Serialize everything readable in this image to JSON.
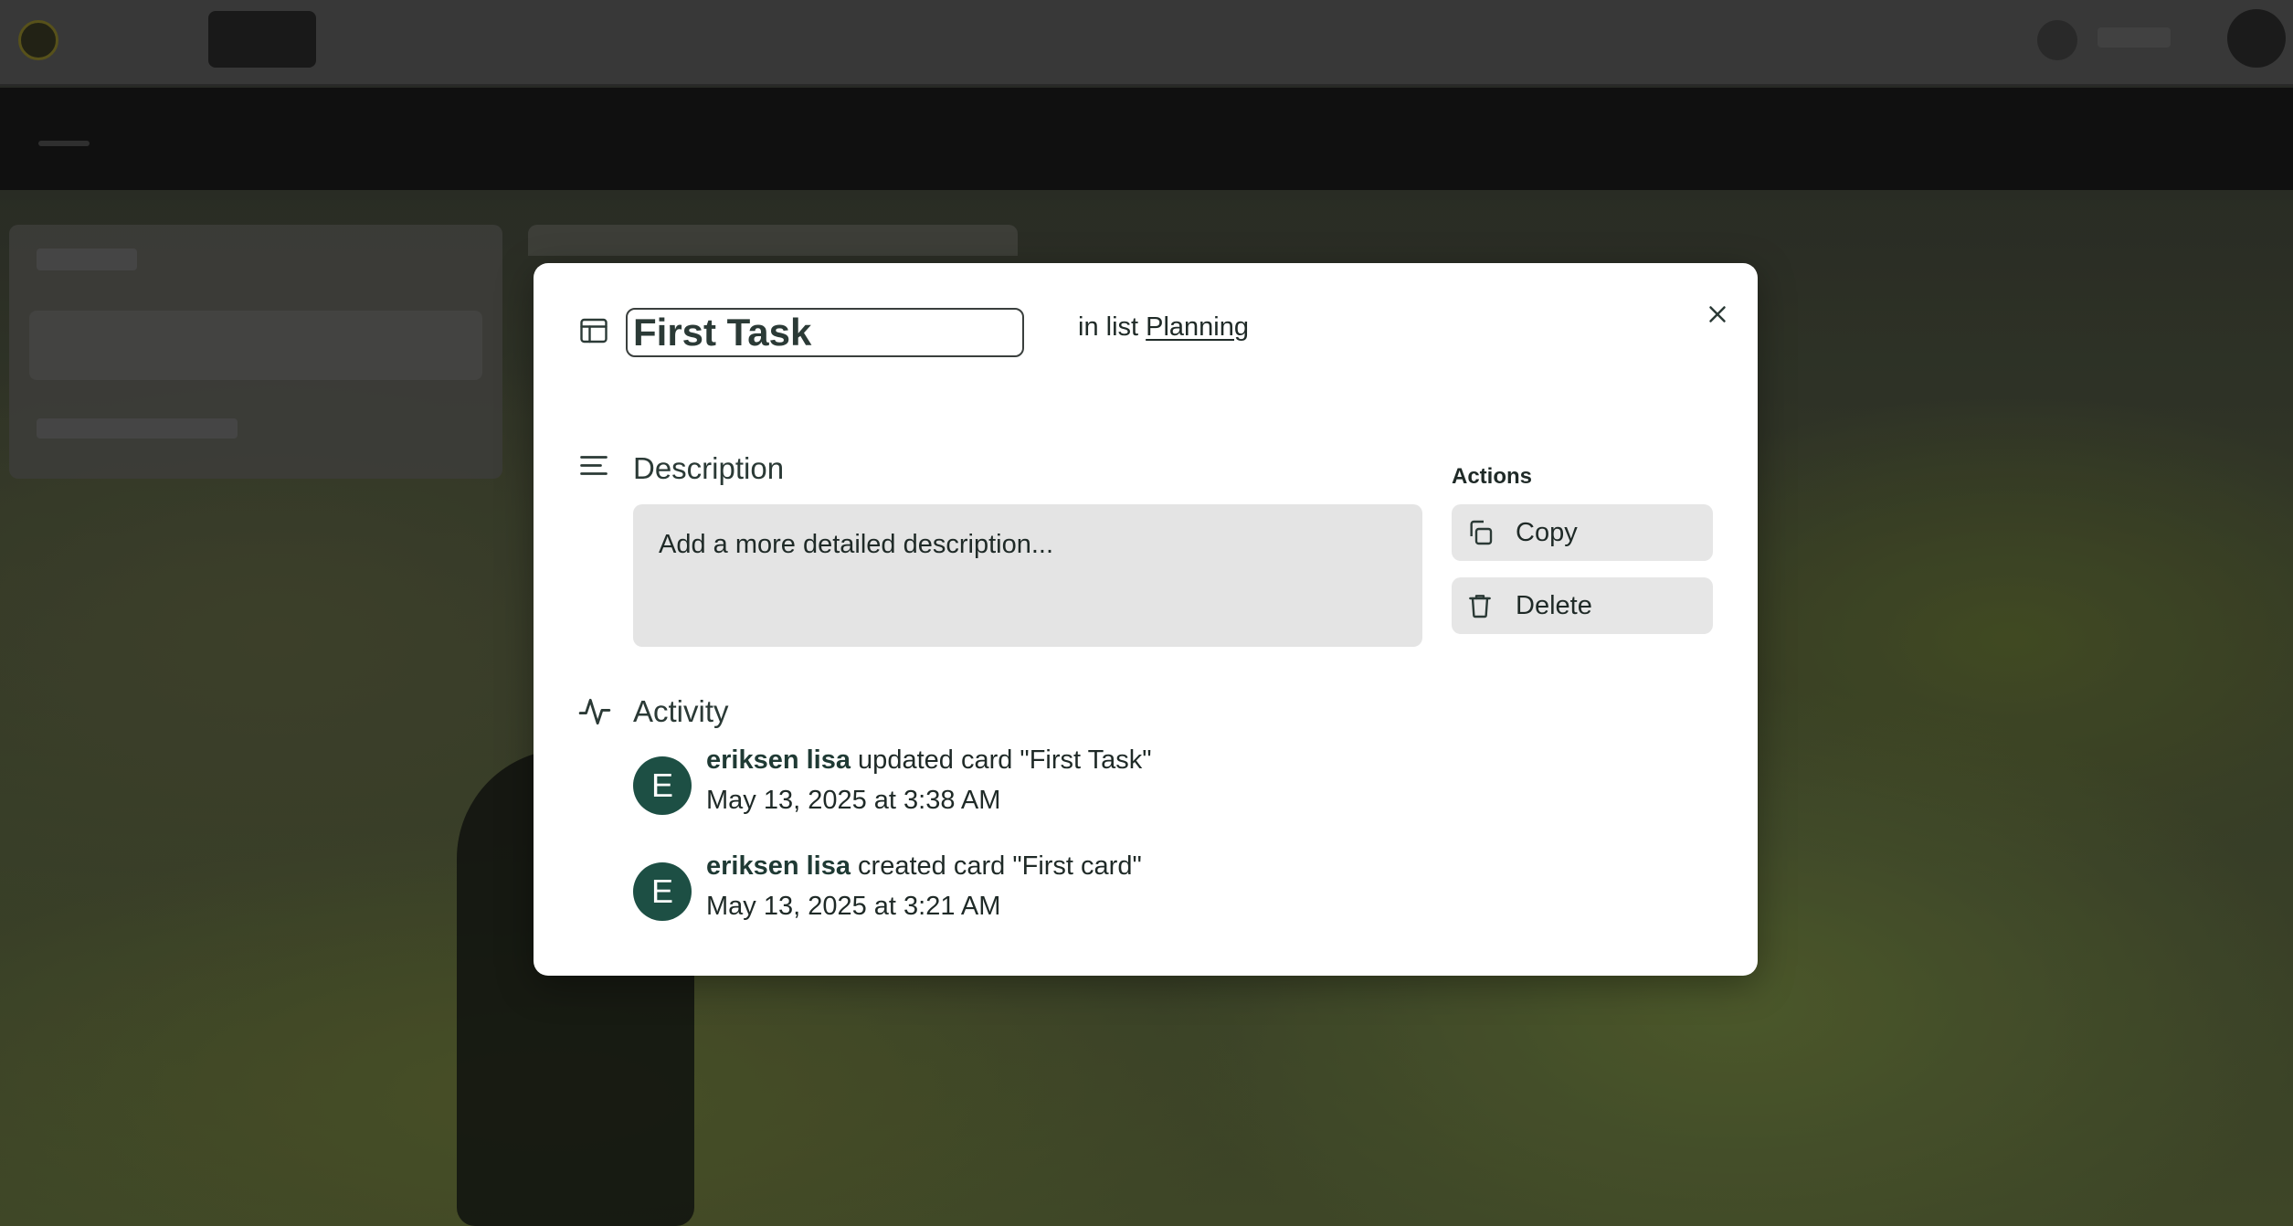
{
  "modal": {
    "title_value": "First Task",
    "in_list_prefix": "in list",
    "list_name": "Planning",
    "description": {
      "heading": "Description",
      "placeholder": "Add a more detailed description..."
    },
    "actions": {
      "heading": "Actions",
      "copy_label": "Copy",
      "delete_label": "Delete"
    },
    "activity": {
      "heading": "Activity",
      "items": [
        {
          "avatar_initial": "E",
          "user": "eriksen lisa",
          "action": " updated card \"First Task\"",
          "time": "May 13, 2025 at 3:38 AM"
        },
        {
          "avatar_initial": "E",
          "user": "eriksen lisa",
          "action": " created card \"First card\"",
          "time": "May 13, 2025 at 3:21 AM"
        }
      ]
    }
  },
  "colors": {
    "avatar_bg": "#1d4f44",
    "button_bg": "#e6e6e6",
    "description_bg": "#e4e4e4"
  }
}
